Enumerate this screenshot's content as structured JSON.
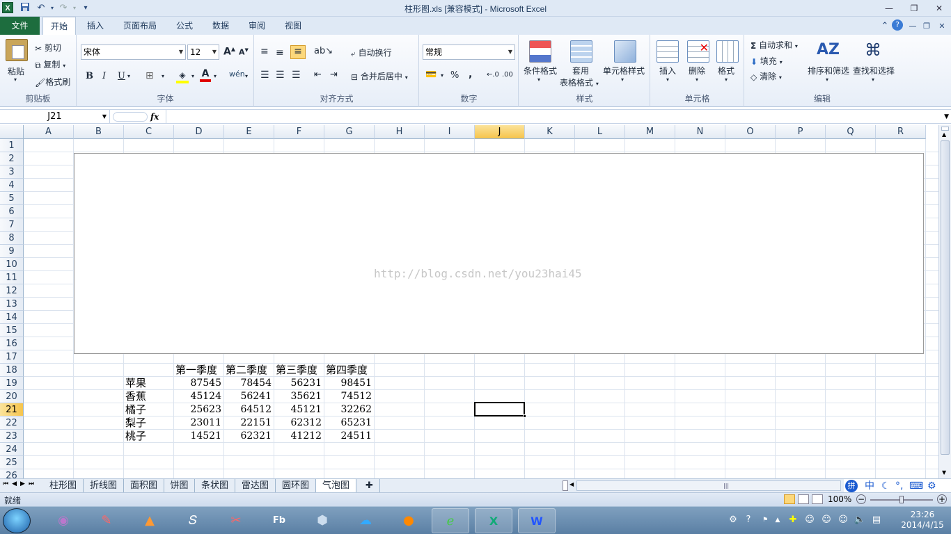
{
  "window": {
    "title": "柱形图.xls  [兼容模式]  -  Microsoft Excel",
    "app_icon": "X"
  },
  "ribbon_tabs": [
    "文件",
    "开始",
    "插入",
    "页面布局",
    "公式",
    "数据",
    "审阅",
    "视图"
  ],
  "active_tab": "开始",
  "clipboard": {
    "paste": "粘贴",
    "cut": "剪切",
    "copy": "复制",
    "format_painter": "格式刷",
    "group": "剪贴板"
  },
  "font": {
    "name": "宋体",
    "size": "12",
    "grow": "A",
    "shrink": "A",
    "bold": "B",
    "italic": "I",
    "underline": "U",
    "group": "字体"
  },
  "alignment": {
    "wrap": "自动换行",
    "merge": "合并后居中",
    "group": "对齐方式"
  },
  "number": {
    "format": "常规",
    "percent": "%",
    "comma": ",",
    "group": "数字"
  },
  "styles": {
    "conditional": "条件格式",
    "table_line1": "套用",
    "table_line2": "表格格式",
    "cell_styles": "单元格样式",
    "group": "样式"
  },
  "cells": {
    "insert": "插入",
    "delete": "删除",
    "format": "格式",
    "group": "单元格"
  },
  "editing": {
    "autosum": "自动求和",
    "fill": "填充",
    "clear": "清除",
    "sort": "排序和筛选",
    "find": "查找和选择",
    "group": "编辑",
    "sigma": "Σ"
  },
  "formula_bar": {
    "name_box": "J21",
    "fx": "fx",
    "formula": ""
  },
  "columns": [
    "A",
    "B",
    "C",
    "D",
    "E",
    "F",
    "G",
    "H",
    "I",
    "J",
    "K",
    "L",
    "M",
    "N",
    "O",
    "P",
    "Q",
    "R"
  ],
  "rows": [
    "1",
    "2",
    "3",
    "4",
    "5",
    "6",
    "7",
    "8",
    "9",
    "10",
    "11",
    "12",
    "13",
    "14",
    "15",
    "16",
    "17",
    "18",
    "19",
    "20",
    "21",
    "22",
    "23",
    "24",
    "25",
    "26"
  ],
  "selected_cell": "J21",
  "chart_watermark": "http://blog.csdn.net/you23hai45",
  "table": {
    "headers": [
      "第一季度",
      "第二季度",
      "第三季度",
      "第四季度"
    ],
    "rows": [
      {
        "label": "苹果",
        "values": [
          "87545",
          "78454",
          "56231",
          "98451"
        ]
      },
      {
        "label": "香蕉",
        "values": [
          "45124",
          "56241",
          "35621",
          "74512"
        ]
      },
      {
        "label": "橘子",
        "values": [
          "25623",
          "64512",
          "45121",
          "32262"
        ]
      },
      {
        "label": "梨子",
        "values": [
          "23011",
          "22151",
          "62312",
          "65231"
        ]
      },
      {
        "label": "桃子",
        "values": [
          "14521",
          "62321",
          "41212",
          "24511"
        ]
      }
    ]
  },
  "sheet_tabs": [
    "柱形图",
    "折线图",
    "面积图",
    "饼图",
    "条状图",
    "雷达图",
    "圆环图",
    "气泡图"
  ],
  "active_sheet": "气泡图",
  "status": {
    "ready": "就绪",
    "zoom": "100%"
  },
  "ime": {
    "label": "中"
  },
  "clock": {
    "time": "23:26",
    "date": "2014/4/15"
  },
  "taskbar_apps": [
    "start",
    "eclipse",
    "notes",
    "matlab",
    "s-app",
    "scissors",
    "flash-builder",
    "box",
    "skydrive",
    "firefox",
    "ie",
    "excel",
    "word"
  ],
  "colors": {
    "file_tab": "#1d6d3e",
    "selected_header": "#f6c44b"
  }
}
